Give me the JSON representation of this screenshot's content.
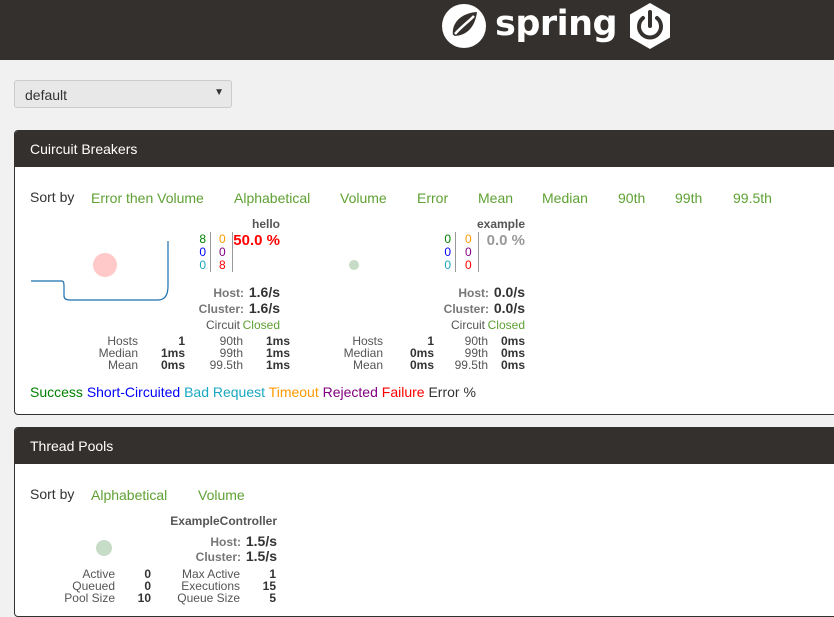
{
  "header": {
    "logo_text": "spring",
    "brand_color": "#34302d",
    "accent_color": "#6db33f",
    "logo_icon": "spring-leaf-icon",
    "boot_icon": "spring-boot-power-icon"
  },
  "filter": {
    "selected": "default"
  },
  "circuit_breakers": {
    "title": "Cuircuit Breakers",
    "sort_label": "Sort by",
    "sort_options": [
      "Error then Volume",
      "Alphabetical",
      "Volume",
      "Error",
      "Mean",
      "Median",
      "90th",
      "99th",
      "99.5th"
    ],
    "items": [
      {
        "name": "hello",
        "success": "8",
        "short_circuited": "0",
        "bad_request": "0",
        "timeout": "0",
        "rejected": "0",
        "failure": "8",
        "error_pct": "50.0 %",
        "host_label": "Host:",
        "host_rate": "1.6/s",
        "cluster_label": "Cluster:",
        "cluster_rate": "1.6/s",
        "circuit_label": "Circuit",
        "circuit_status": "Closed",
        "stats": {
          "hosts_label": "Hosts",
          "hosts": "1",
          "median_label": "Median",
          "median": "1ms",
          "mean_label": "Mean",
          "mean": "0ms",
          "p90_label": "90th",
          "p90": "1ms",
          "p99_label": "99th",
          "p99": "1ms",
          "p995_label": "99.5th",
          "p995": "1ms"
        }
      },
      {
        "name": "example",
        "success": "0",
        "short_circuited": "0",
        "bad_request": "0",
        "timeout": "0",
        "rejected": "0",
        "failure": "0",
        "error_pct": "0.0 %",
        "host_label": "Host:",
        "host_rate": "0.0/s",
        "cluster_label": "Cluster:",
        "cluster_rate": "0.0/s",
        "circuit_label": "Circuit",
        "circuit_status": "Closed",
        "stats": {
          "hosts_label": "Hosts",
          "hosts": "1",
          "median_label": "Median",
          "median": "0ms",
          "mean_label": "Mean",
          "mean": "0ms",
          "p90_label": "90th",
          "p90": "0ms",
          "p99_label": "99th",
          "p99": "0ms",
          "p995_label": "99.5th",
          "p995": "0ms"
        }
      }
    ],
    "legend": [
      {
        "label": "Success",
        "color": "#008000"
      },
      {
        "label": "Short-Circuited",
        "color": "#0000ff"
      },
      {
        "label": "Bad Request",
        "color": "#19a8c1"
      },
      {
        "label": "Timeout",
        "color": "#ff9900"
      },
      {
        "label": "Rejected",
        "color": "#800080"
      },
      {
        "label": "Failure",
        "color": "#ff0000"
      },
      {
        "label": "Error %",
        "color": "#333333"
      }
    ]
  },
  "thread_pools": {
    "title": "Thread Pools",
    "sort_label": "Sort by",
    "sort_options": [
      "Alphabetical",
      "Volume"
    ],
    "items": [
      {
        "name": "ExampleController",
        "host_label": "Host:",
        "host_rate": "1.5/s",
        "cluster_label": "Cluster:",
        "cluster_rate": "1.5/s",
        "active_label": "Active",
        "active": "0",
        "queued_label": "Queued",
        "queued": "0",
        "pool_size_label": "Pool Size",
        "pool_size": "10",
        "max_active_label": "Max Active",
        "max_active": "1",
        "executions_label": "Executions",
        "executions": "15",
        "queue_size_label": "Queue Size",
        "queue_size": "5"
      }
    ]
  }
}
